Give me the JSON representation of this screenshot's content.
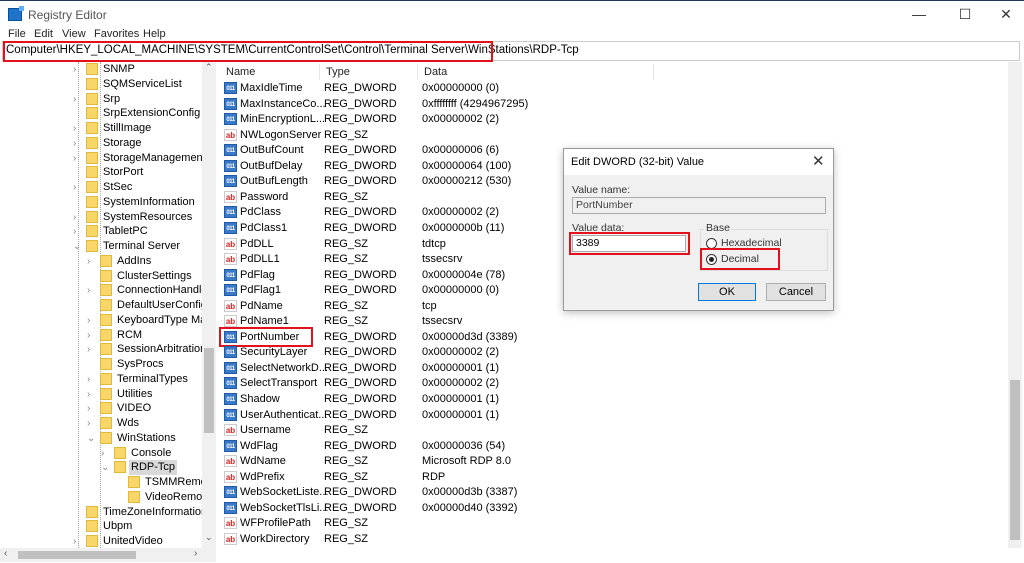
{
  "window": {
    "title": "Registry Editor",
    "minimize": "—",
    "maximize": "☐",
    "close": "✕"
  },
  "menu": [
    "File",
    "Edit",
    "View",
    "Favorites",
    "Help"
  ],
  "address": "Computer\\HKEY_LOCAL_MACHINE\\SYSTEM\\CurrentControlSet\\Control\\Terminal Server\\WinStations\\RDP-Tcp",
  "tree": [
    {
      "label": "SNMP",
      "level": 0,
      "exp": "collapsed"
    },
    {
      "label": "SQMServiceList",
      "level": 0,
      "exp": "none"
    },
    {
      "label": "Srp",
      "level": 0,
      "exp": "collapsed"
    },
    {
      "label": "SrpExtensionConfig",
      "level": 0,
      "exp": "none"
    },
    {
      "label": "StillImage",
      "level": 0,
      "exp": "collapsed"
    },
    {
      "label": "Storage",
      "level": 0,
      "exp": "collapsed"
    },
    {
      "label": "StorageManagement",
      "level": 0,
      "exp": "collapsed"
    },
    {
      "label": "StorPort",
      "level": 0,
      "exp": "none"
    },
    {
      "label": "StSec",
      "level": 0,
      "exp": "collapsed"
    },
    {
      "label": "SystemInformation",
      "level": 0,
      "exp": "none"
    },
    {
      "label": "SystemResources",
      "level": 0,
      "exp": "collapsed"
    },
    {
      "label": "TabletPC",
      "level": 0,
      "exp": "collapsed"
    },
    {
      "label": "Terminal Server",
      "level": 0,
      "exp": "expanded"
    },
    {
      "label": "AddIns",
      "level": 1,
      "exp": "collapsed"
    },
    {
      "label": "ClusterSettings",
      "level": 1,
      "exp": "none"
    },
    {
      "label": "ConnectionHandler",
      "level": 1,
      "exp": "collapsed"
    },
    {
      "label": "DefaultUserConfiguration",
      "level": 1,
      "exp": "none"
    },
    {
      "label": "KeyboardType Mapping",
      "level": 1,
      "exp": "collapsed"
    },
    {
      "label": "RCM",
      "level": 1,
      "exp": "collapsed"
    },
    {
      "label": "SessionArbitrationHelper",
      "level": 1,
      "exp": "collapsed"
    },
    {
      "label": "SysProcs",
      "level": 1,
      "exp": "none"
    },
    {
      "label": "TerminalTypes",
      "level": 1,
      "exp": "collapsed"
    },
    {
      "label": "Utilities",
      "level": 1,
      "exp": "collapsed"
    },
    {
      "label": "VIDEO",
      "level": 1,
      "exp": "collapsed"
    },
    {
      "label": "Wds",
      "level": 1,
      "exp": "collapsed"
    },
    {
      "label": "WinStations",
      "level": 1,
      "exp": "expanded"
    },
    {
      "label": "Console",
      "level": 2,
      "exp": "collapsed"
    },
    {
      "label": "RDP-Tcp",
      "level": 2,
      "exp": "expanded",
      "selected": true
    },
    {
      "label": "TSMMRemotingAllowedApps",
      "level": 3,
      "exp": "none"
    },
    {
      "label": "VideoRemotingWindowNames",
      "level": 3,
      "exp": "none"
    },
    {
      "label": "TimeZoneInformation",
      "level": 0,
      "exp": "none"
    },
    {
      "label": "Ubpm",
      "level": 0,
      "exp": "none"
    },
    {
      "label": "UnitedVideo",
      "level": 0,
      "exp": "collapsed"
    }
  ],
  "columns": {
    "name": "Name",
    "type": "Type",
    "data": "Data"
  },
  "values": [
    {
      "name": "MaxIdleTime",
      "type": "REG_DWORD",
      "data": "0x00000000 (0)"
    },
    {
      "name": "MaxInstanceCo...",
      "type": "REG_DWORD",
      "data": "0xffffffff (4294967295)"
    },
    {
      "name": "MinEncryptionL...",
      "type": "REG_DWORD",
      "data": "0x00000002 (2)"
    },
    {
      "name": "NWLogonServer",
      "type": "REG_SZ",
      "data": ""
    },
    {
      "name": "OutBufCount",
      "type": "REG_DWORD",
      "data": "0x00000006 (6)"
    },
    {
      "name": "OutBufDelay",
      "type": "REG_DWORD",
      "data": "0x00000064 (100)"
    },
    {
      "name": "OutBufLength",
      "type": "REG_DWORD",
      "data": "0x00000212 (530)"
    },
    {
      "name": "Password",
      "type": "REG_SZ",
      "data": ""
    },
    {
      "name": "PdClass",
      "type": "REG_DWORD",
      "data": "0x00000002 (2)"
    },
    {
      "name": "PdClass1",
      "type": "REG_DWORD",
      "data": "0x0000000b (11)"
    },
    {
      "name": "PdDLL",
      "type": "REG_SZ",
      "data": "tdtcp"
    },
    {
      "name": "PdDLL1",
      "type": "REG_SZ",
      "data": "tssecsrv"
    },
    {
      "name": "PdFlag",
      "type": "REG_DWORD",
      "data": "0x0000004e (78)"
    },
    {
      "name": "PdFlag1",
      "type": "REG_DWORD",
      "data": "0x00000000 (0)"
    },
    {
      "name": "PdName",
      "type": "REG_SZ",
      "data": "tcp"
    },
    {
      "name": "PdName1",
      "type": "REG_SZ",
      "data": "tssecsrv"
    },
    {
      "name": "PortNumber",
      "type": "REG_DWORD",
      "data": "0x00000d3d (3389)",
      "highlight": true
    },
    {
      "name": "SecurityLayer",
      "type": "REG_DWORD",
      "data": "0x00000002 (2)"
    },
    {
      "name": "SelectNetworkD...",
      "type": "REG_DWORD",
      "data": "0x00000001 (1)"
    },
    {
      "name": "SelectTransport",
      "type": "REG_DWORD",
      "data": "0x00000002 (2)"
    },
    {
      "name": "Shadow",
      "type": "REG_DWORD",
      "data": "0x00000001 (1)"
    },
    {
      "name": "UserAuthenticat...",
      "type": "REG_DWORD",
      "data": "0x00000001 (1)"
    },
    {
      "name": "Username",
      "type": "REG_SZ",
      "data": ""
    },
    {
      "name": "WdFlag",
      "type": "REG_DWORD",
      "data": "0x00000036 (54)"
    },
    {
      "name": "WdName",
      "type": "REG_SZ",
      "data": "Microsoft RDP 8.0"
    },
    {
      "name": "WdPrefix",
      "type": "REG_SZ",
      "data": "RDP"
    },
    {
      "name": "WebSocketListe...",
      "type": "REG_DWORD",
      "data": "0x00000d3b (3387)"
    },
    {
      "name": "WebSocketTlsLi...",
      "type": "REG_DWORD",
      "data": "0x00000d40 (3392)"
    },
    {
      "name": "WFProfilePath",
      "type": "REG_SZ",
      "data": ""
    },
    {
      "name": "WorkDirectory",
      "type": "REG_SZ",
      "data": ""
    }
  ],
  "dialog": {
    "title": "Edit DWORD (32-bit) Value",
    "close": "✕",
    "value_name_label": "Value name:",
    "value_name": "PortNumber",
    "value_data_label": "Value data:",
    "value_data": "3389",
    "base_label": "Base",
    "hex_label": "Hexadecimal",
    "dec_label": "Decimal",
    "selected_base": "Decimal",
    "ok": "OK",
    "cancel": "Cancel"
  },
  "colors": {
    "highlight": "#e3111b",
    "selection": "#d9d9d9",
    "accent": "#0078d7"
  }
}
